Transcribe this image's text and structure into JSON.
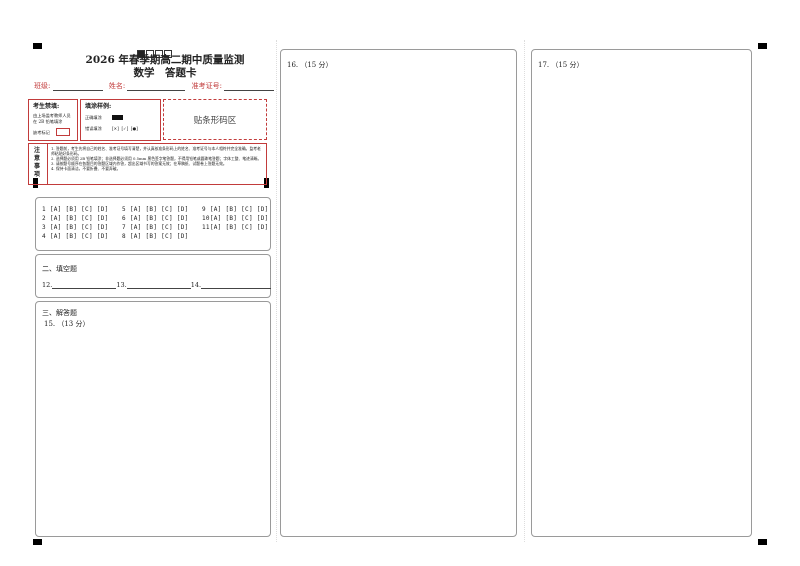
{
  "header": {
    "title": "2026 年春季期高二期中质量监测",
    "subtitle": "数学　答题卡"
  },
  "student_info": {
    "class_label": "班级:",
    "name_label": "姓名:",
    "exam_id_label": "准考证号:"
  },
  "candidate_notes": {
    "heading": "考生禁填:",
    "line1": "由上场监考教师人员",
    "line2": "在 2B 铅笔填涂",
    "absent_label": "缺考标记"
  },
  "fill_example": {
    "heading": "填涂样例:",
    "correct_label": "正确填涂",
    "wrong_label": "错误填涂",
    "wrong_marks": "[✕]  [✓]  [●]"
  },
  "barcode_area": {
    "label": "贴条形码区"
  },
  "notice": {
    "side_label": "注意事项",
    "items": [
      "1. 答题前，考生先将自己的姓名、准考证号填写清楚，并认真核准条形码上的姓名、准考证号与本人相符并完全准确。监考老师粘贴好条形码。",
      "2. 选择题必须用 2B 铅笔填涂；非选择题必须用 0.5mm 黑色签字笔答题，不得用铅笔或圆珠笔答题；字体工整、笔迹清晰。",
      "3. 请按题号顺序在各题目的答题区域内作答，超出区域书写的答案无效；在草稿纸、试题卷上答题无效。",
      "4. 保持卡面清洁，不要折叠、不要弄破。"
    ]
  },
  "mcq": {
    "options": "[A] [B] [C] [D]",
    "columns": [
      [
        "1",
        "2",
        "3",
        "4"
      ],
      [
        "5",
        "6",
        "7",
        "8"
      ],
      [
        "9",
        "10",
        "11"
      ]
    ]
  },
  "fill_blank": {
    "heading": "二、填空题",
    "q12": "12.",
    "q13": "13.",
    "q14": "14."
  },
  "essay": {
    "heading": "三、解答题",
    "q15": "15. （13 分）",
    "q16": "16. （15 分）",
    "q17": "17. （15 分）"
  }
}
